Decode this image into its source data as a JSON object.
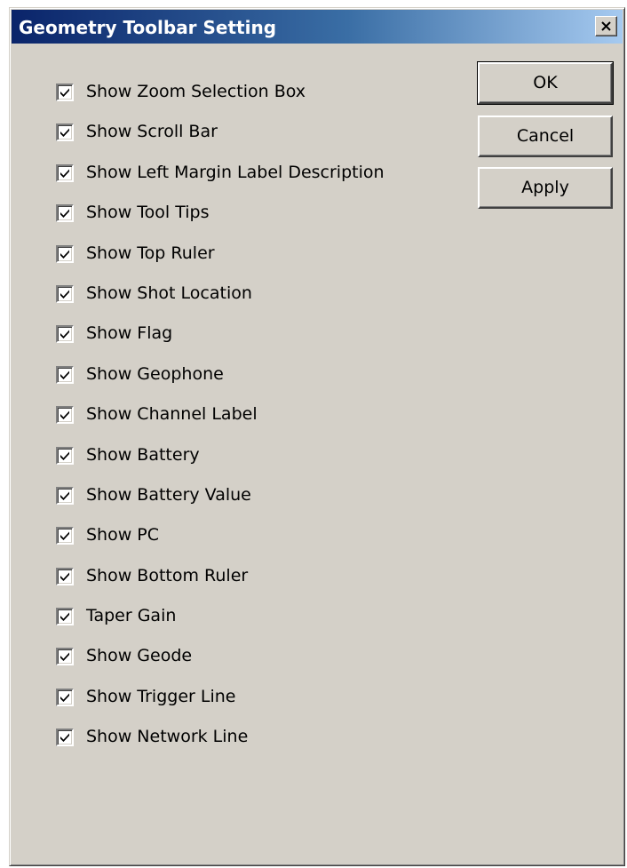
{
  "dialog": {
    "title": "Geometry Toolbar Setting",
    "close_glyph": "×"
  },
  "options": [
    {
      "label": "Show Zoom Selection Box",
      "checked": true
    },
    {
      "label": "Show Scroll Bar",
      "checked": true
    },
    {
      "label": "Show Left Margin Label Description",
      "checked": true
    },
    {
      "label": "Show Tool Tips",
      "checked": true
    },
    {
      "label": "Show Top Ruler",
      "checked": true
    },
    {
      "label": "Show Shot Location",
      "checked": true
    },
    {
      "label": "Show Flag",
      "checked": true
    },
    {
      "label": "Show Geophone",
      "checked": true
    },
    {
      "label": "Show Channel Label",
      "checked": true
    },
    {
      "label": "Show Battery",
      "checked": true
    },
    {
      "label": "Show Battery Value",
      "checked": true
    },
    {
      "label": "Show PC",
      "checked": true
    },
    {
      "label": "Show Bottom Ruler",
      "checked": true
    },
    {
      "label": "Taper Gain",
      "checked": true
    },
    {
      "label": "Show Geode",
      "checked": true
    },
    {
      "label": "Show Trigger Line",
      "checked": true
    },
    {
      "label": "Show Network Line",
      "checked": true
    }
  ],
  "buttons": {
    "ok": "OK",
    "cancel": "Cancel",
    "apply": "Apply"
  },
  "colors": {
    "title_gradient_start": "#0a246a",
    "title_gradient_end": "#a6caf0",
    "dialog_face": "#d4d0c8"
  },
  "icons": {
    "close": "close-icon",
    "check": "checkmark-icon"
  }
}
